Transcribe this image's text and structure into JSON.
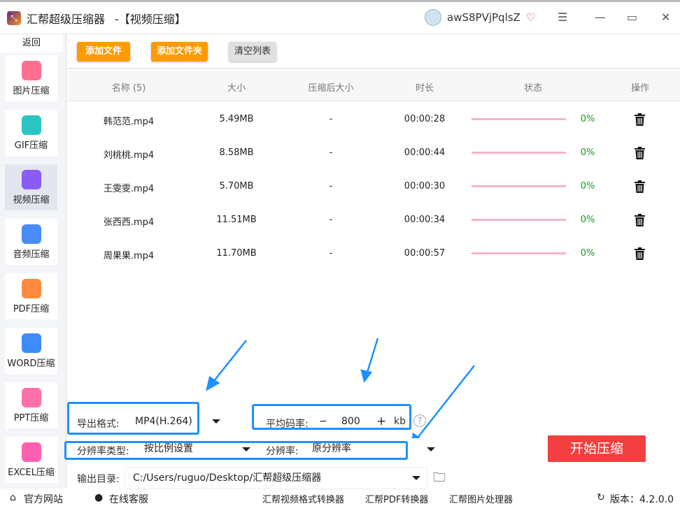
{
  "app": {
    "title": "汇帮超级压缩器",
    "subtitle": "-【视频压缩】",
    "username": "awS8PVjPqlsZ"
  },
  "sidebar": {
    "back": "返回",
    "items": [
      {
        "label": "图片压缩",
        "color": "#ff6f8f"
      },
      {
        "label": "GIF压缩",
        "color": "#2bc4c4"
      },
      {
        "label": "视频压缩",
        "color": "#8a5cf6"
      },
      {
        "label": "音频压缩",
        "color": "#4a8cf7"
      },
      {
        "label": "PDF压缩",
        "color": "#ff8a3d"
      },
      {
        "label": "WORD压缩",
        "color": "#3d8cf7"
      },
      {
        "label": "PPT压缩",
        "color": "#ff6fa8"
      },
      {
        "label": "EXCEL压缩",
        "color": "#ff5fb0"
      }
    ]
  },
  "toolbar": {
    "add_file": "添加文件",
    "add_folder": "添加文件夹",
    "clear": "清空列表"
  },
  "table": {
    "headers": [
      "名称 (5)",
      "大小",
      "压缩后大小",
      "时长",
      "状态",
      "操作"
    ],
    "rows": [
      {
        "name": "韩范范.mp4",
        "size": "5.49MB",
        "after": "-",
        "duration": "00:00:28",
        "progress": "0%"
      },
      {
        "name": "刘桃桃.mp4",
        "size": "8.58MB",
        "after": "-",
        "duration": "00:00:44",
        "progress": "0%"
      },
      {
        "name": "王雯雯.mp4",
        "size": "5.70MB",
        "after": "-",
        "duration": "00:00:30",
        "progress": "0%"
      },
      {
        "name": "张西西.mp4",
        "size": "11.51MB",
        "after": "-",
        "duration": "00:00:34",
        "progress": "0%"
      },
      {
        "name": "周果果.mp4",
        "size": "11.70MB",
        "after": "-",
        "duration": "00:00:57",
        "progress": "0%"
      }
    ]
  },
  "settings": {
    "format_label": "导出格式:",
    "format_value": "MP4(H.264)",
    "bitrate_label": "平均码率:",
    "bitrate_minus": "−",
    "bitrate_value": "800",
    "bitrate_plus": "+",
    "bitrate_unit": "kb",
    "help": "?",
    "restype_label": "分辨率类型:",
    "restype_value": "按比例设置",
    "res_label": "分辨率:",
    "res_value": "原分辨率",
    "output_label": "输出目录:",
    "output_value": "C:/Users/ruguo/Desktop/汇帮超级压缩器"
  },
  "start": "开始压缩",
  "footer": {
    "site": "官方网站",
    "service": "在线客服",
    "link1": "汇帮视频格式转换器",
    "link2": "汇帮PDF转换器",
    "link3": "汇帮图片处理器",
    "version": "版本：4.2.0.0"
  }
}
